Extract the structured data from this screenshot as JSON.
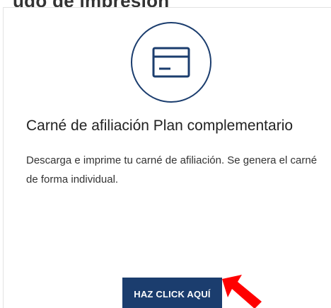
{
  "header": {
    "clipped_text": "ugo de impresión"
  },
  "card": {
    "icon": "credit-card-icon",
    "title": "Carné de afiliación Plan complementario",
    "description": "Descarga e imprime tu carné de afiliación. Se genera el carné de forma individual.",
    "button_label": "HAZ CLICK AQUÍ"
  },
  "annotation": {
    "icon": "red-pointer-arrow-icon"
  },
  "colors": {
    "accent": "#1b3d6e",
    "annotation": "#ff0000",
    "border": "#e3e3e3"
  }
}
